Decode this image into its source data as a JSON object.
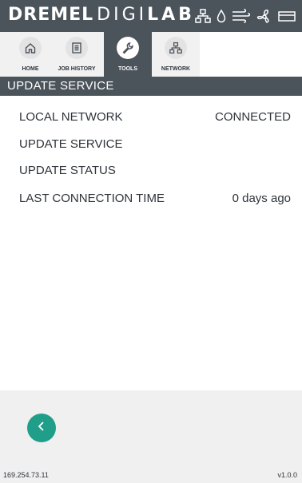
{
  "header": {
    "brand_dremel": "DREMEL",
    "brand_digi": "DIGI",
    "brand_lab": "LAB",
    "status_icons": [
      "network-icon",
      "droplet-icon",
      "fan-icon",
      "fan-blades-icon",
      "battery-icon"
    ]
  },
  "tabs": [
    {
      "label": "HOME",
      "icon": "home-icon",
      "active": false
    },
    {
      "label": "JOB HISTORY",
      "icon": "document-icon",
      "active": false
    },
    {
      "label": "TOOLS",
      "icon": "wrench-icon",
      "active": true
    },
    {
      "label": "NETWORK",
      "icon": "network-icon",
      "active": false
    }
  ],
  "section": {
    "title": "UPDATE SERVICE"
  },
  "rows": [
    {
      "key": "LOCAL NETWORK",
      "value": "CONNECTED"
    },
    {
      "key": "UPDATE SERVICE",
      "value": ""
    },
    {
      "key": "UPDATE STATUS",
      "value": ""
    },
    {
      "key": "LAST CONNECTION TIME",
      "value": "0 days ago"
    }
  ],
  "footer": {
    "ip_address": "169.254.73.11",
    "version": "v1.0.0",
    "back_icon": "chevron-left-icon"
  },
  "colors": {
    "header": "#4b535b",
    "accent": "#1f9e8a",
    "footer_bg": "#f0f0f0"
  }
}
